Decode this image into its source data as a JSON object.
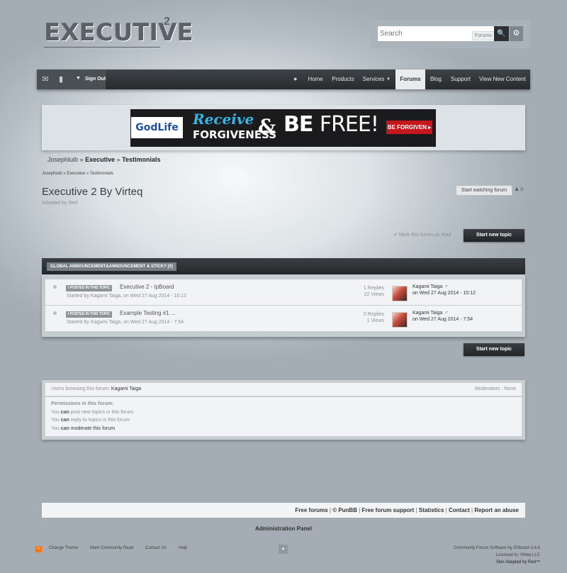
{
  "logo": {
    "text": "EXECUTIVE",
    "sup": "2"
  },
  "search": {
    "placeholder": "Search",
    "scope": "Forums",
    "search_icon": "search-icon",
    "settings_icon": "gear-icon"
  },
  "nav": {
    "signout": "Sign Out",
    "items": [
      "Home",
      "Products",
      "Services",
      "Forums",
      "Blog",
      "Support",
      "View New Content"
    ],
    "active": "Forums"
  },
  "banner": {
    "logo": "GodLife",
    "line1": "Receive",
    "line2": "FORGIVENESS",
    "amp": "&",
    "be": "BE",
    "free": "FREE!",
    "button": "BE FORGIVEN ▸"
  },
  "breadcrumb_main": {
    "a": "Josephluib",
    "sep1": "»",
    "b": "Executive",
    "sep2": "»",
    "c": "Testimonials"
  },
  "breadcrumb_small": "Josephluib » Executive » Testimonials",
  "forum": {
    "title": "Executive 2 By Virteq",
    "subtitle": "Adapted by Red",
    "watch_label": "Start watching forum",
    "follower_count": "0",
    "mark_read": "Mark this forum as read",
    "new_topic": "Start new topic"
  },
  "announcements": {
    "header": "GLOBAL ANNOUNCEMENT&ANNOUNCEMENT & STICKY [0]",
    "topics": [
      {
        "badge": "I POSTED IN THIS TOPIC",
        "title": "Executive 2 - IpBoard",
        "started": "Started by Kagami Taiga, on Wed 27 Aug 2014 - 10:12",
        "replies": "1 Replies",
        "views": "22 Views",
        "last_user": "Kagami Taiga",
        "last_date": "on Wed 27 Aug 2014 - 10:12"
      },
      {
        "badge": "I POSTED IN THIS TOPIC",
        "title": "Example Testing #1 ...",
        "started": "Started by Kagami Taiga, on Wed 27 Aug 2014 - 7:54",
        "replies": "0 Replies",
        "views": "1 Views",
        "last_user": "Kagami Taiga",
        "last_date": "on Wed 27 Aug 2014 - 7:54"
      }
    ]
  },
  "stats": {
    "browsing_label": "Users browsing this forum:",
    "browsing_user": "Kagami Taiga",
    "moderators": "Moderators : None",
    "perm_title": "Permissions in this forum:",
    "perms": [
      {
        "pre": "You ",
        "can": "can",
        "post": " post new topics in this forum"
      },
      {
        "pre": "You ",
        "can": "can",
        "post": " reply to topics in this forum"
      },
      {
        "pre": "You ",
        "can": "can",
        "post": " moderate this forum"
      }
    ]
  },
  "footer": {
    "links": [
      "Free forums",
      "© PunBB",
      "Free forum support",
      "Statistics",
      "Contact",
      "Report an abuse"
    ],
    "admin": "Administration Panel",
    "bottom_links": [
      "Change Theme",
      "Mark Community Read",
      "Contact Us",
      "Help"
    ],
    "powered1": "Community Forum Software by IP.Board 3.4.6",
    "powered2": "Licensed to: Virteq LLC",
    "powered3": "Skin Adapted by Red™"
  },
  "colors": {
    "nav_bg": "#272b2e",
    "accent_red": "#c6171e",
    "banner_blue": "#33b6e6"
  }
}
